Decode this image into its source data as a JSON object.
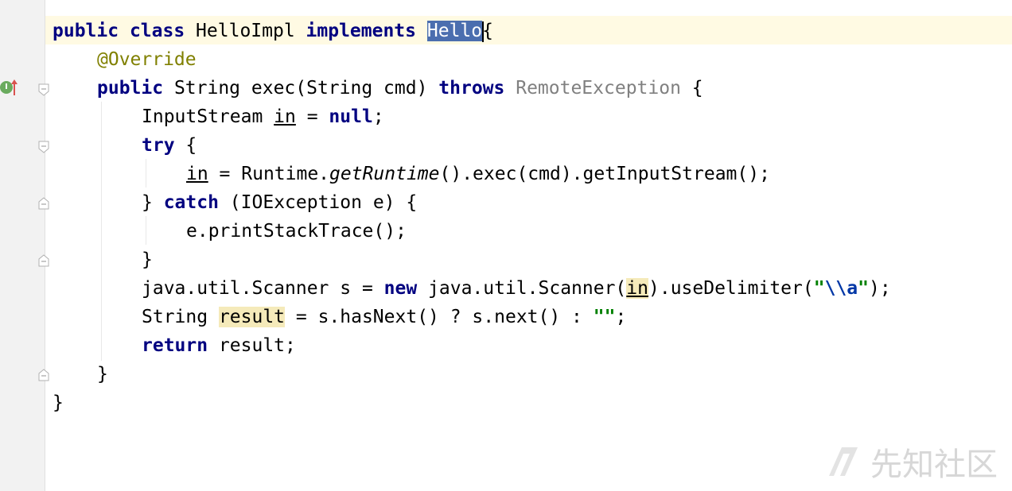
{
  "gutter": {
    "override_marker": "I"
  },
  "code": {
    "l1_kw1": "public",
    "l1_kw2": "class",
    "l1_name": " HelloImpl ",
    "l1_kw3": "implements",
    "l1_sel": "Hello",
    "l1_brace": "{",
    "l2_ann": "@Override",
    "l3_kw1": "public",
    "l3_text": " String exec(String cmd) ",
    "l3_kw2": "throws",
    "l3_grey": " RemoteException",
    "l3_end": " {",
    "l4_text": "InputStream ",
    "l4_var": "in",
    "l4_mid": " = ",
    "l4_kw": "null",
    "l4_end": ";",
    "l5_kw": "try",
    "l5_end": " {",
    "l6_var": "in",
    "l6_a": " = Runtime.",
    "l6_italic": "getRuntime",
    "l6_b": "().exec(cmd).getInputStream();",
    "l7_a": "} ",
    "l7_kw": "catch",
    "l7_b": " (IOException e) {",
    "l8_text": "e.printStackTrace();",
    "l9_text": "}",
    "l10_a": "java.util.Scanner s = ",
    "l10_kw": "new",
    "l10_b": " java.util.Scanner(",
    "l10_var": "in",
    "l10_c": ").useDelimiter(",
    "l10_q1": "\"",
    "l10_esc": "\\\\a",
    "l10_q2": "\"",
    "l10_end": ");",
    "l11_a": "String ",
    "l11_var": "result",
    "l11_b": " = s.hasNext() ? s.next() : ",
    "l11_str": "\"\"",
    "l11_end": ";",
    "l12_kw": "return",
    "l12_text": " result;",
    "l13_text": "}",
    "l14_text": "}"
  },
  "watermark": {
    "text": "先知社区"
  }
}
